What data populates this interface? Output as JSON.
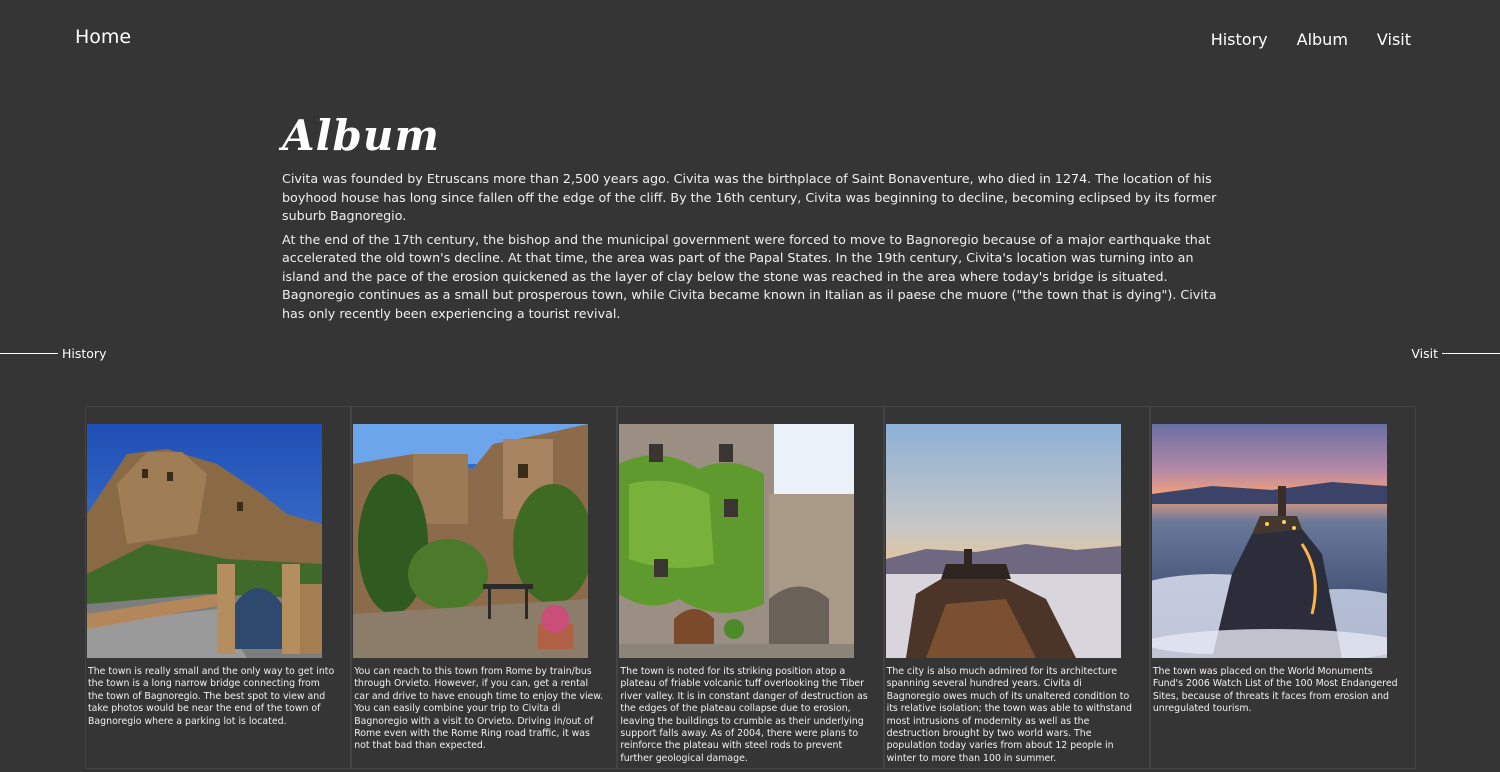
{
  "nav": {
    "home": "Home",
    "links": [
      "History",
      "Album",
      "Visit"
    ]
  },
  "page": {
    "title": "Album",
    "paragraphs": [
      "Civita was founded by Etruscans more than 2,500 years ago. Civita was the birthplace of Saint Bonaventure, who died in 1274. The location of his boyhood house has long since fallen off the edge of the cliff. By the 16th century, Civita was beginning to decline, becoming eclipsed by its former suburb Bagnoregio.",
      "At the end of the 17th century, the bishop and the municipal government were forced to move to Bagnoregio because of a major earthquake that accelerated the old town's decline. At that time, the area was part of the Papal States. In the 19th century, Civita's location was turning into an island and the pace of the erosion quickened as the layer of clay below the stone was reached in the area where today's bridge is situated. Bagnoregio continues as a small but prosperous town, while Civita became known in Italian as il paese che muore (\"the town that is dying\"). Civita has only recently been experiencing a tourist revival."
    ]
  },
  "side_nav": {
    "prev": "History",
    "next": "Visit"
  },
  "gallery": [
    {
      "caption": "The town is really small and the only way to get into the town is a long narrow bridge connecting from the town of Bagnoregio. The best spot to view and take photos would be near the end of the town of Bagnoregio where a parking lot is located."
    },
    {
      "caption": "You can reach to this town from Rome by train/bus through Orvieto. However, if you can, get a rental car and drive to have enough time to enjoy the view. You can easily combine your trip to Civita di Bagnoregio with a visit to Orvieto. Driving in/out of Rome even with the Rome Ring road traffic, it was not that bad than expected."
    },
    {
      "caption": "The town is noted for its striking position atop a plateau of friable volcanic tuff overlooking the Tiber river valley. It is in constant danger of destruction as the edges of the plateau collapse due to erosion, leaving the buildings to crumble as their underlying support falls away. As of 2004, there were plans to reinforce the plateau with steel rods to prevent further geological damage."
    },
    {
      "caption": "The city is also much admired for its architecture spanning several hundred years. Civita di Bagnoregio owes much of its unaltered condition to its relative isolation; the town was able to withstand most intrusions of modernity as well as the destruction brought by two world wars. The population today varies from about 12 people in winter to more than 100 in summer."
    },
    {
      "caption": "The town was placed on the World Monuments Fund's 2006 Watch List of the 100 Most Endangered Sites, because of threats it faces from erosion and unregulated tourism."
    }
  ]
}
